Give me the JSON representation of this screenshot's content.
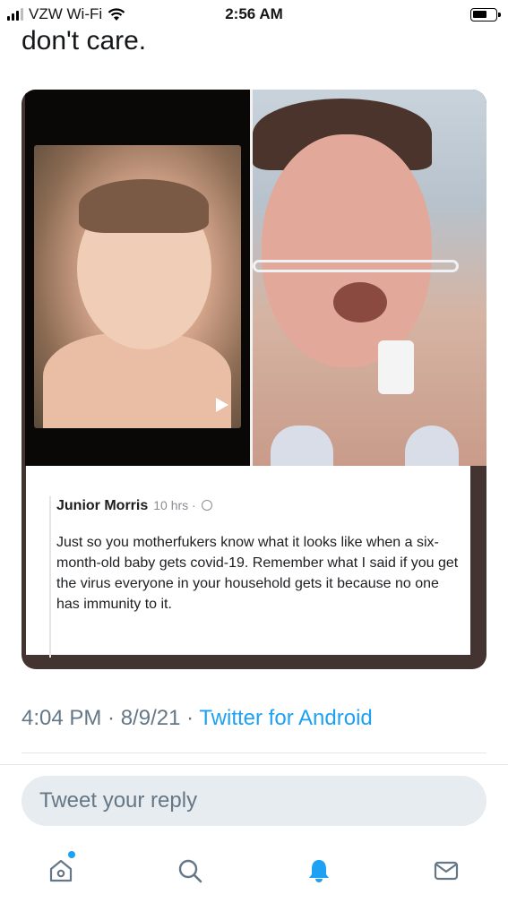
{
  "status_bar": {
    "carrier": "VZW Wi-Fi",
    "time": "2:56 AM"
  },
  "tweet": {
    "text_tail": "don't care.",
    "embedded_post": {
      "author": "Junior Morris",
      "time_ago": "10 hrs",
      "separator": "·",
      "body": "Just so you motherfukers know what it looks like when a six-month-old baby gets covid-19. Remember what I said if you get the virus everyone in your household gets it because no one has immunity to it."
    },
    "timestamp": "4:04 PM · 8/9/21 · ",
    "source": "Twitter for Android"
  },
  "reply": {
    "placeholder": "Tweet your reply"
  },
  "tabs": [
    {
      "name": "home",
      "icon": "home-icon"
    },
    {
      "name": "search",
      "icon": "search-icon"
    },
    {
      "name": "notifications",
      "icon": "bell-icon"
    },
    {
      "name": "messages",
      "icon": "mail-icon"
    }
  ],
  "colors": {
    "accent": "#1da1f2",
    "muted": "#657786",
    "reply_bg": "#e6ecf0"
  }
}
